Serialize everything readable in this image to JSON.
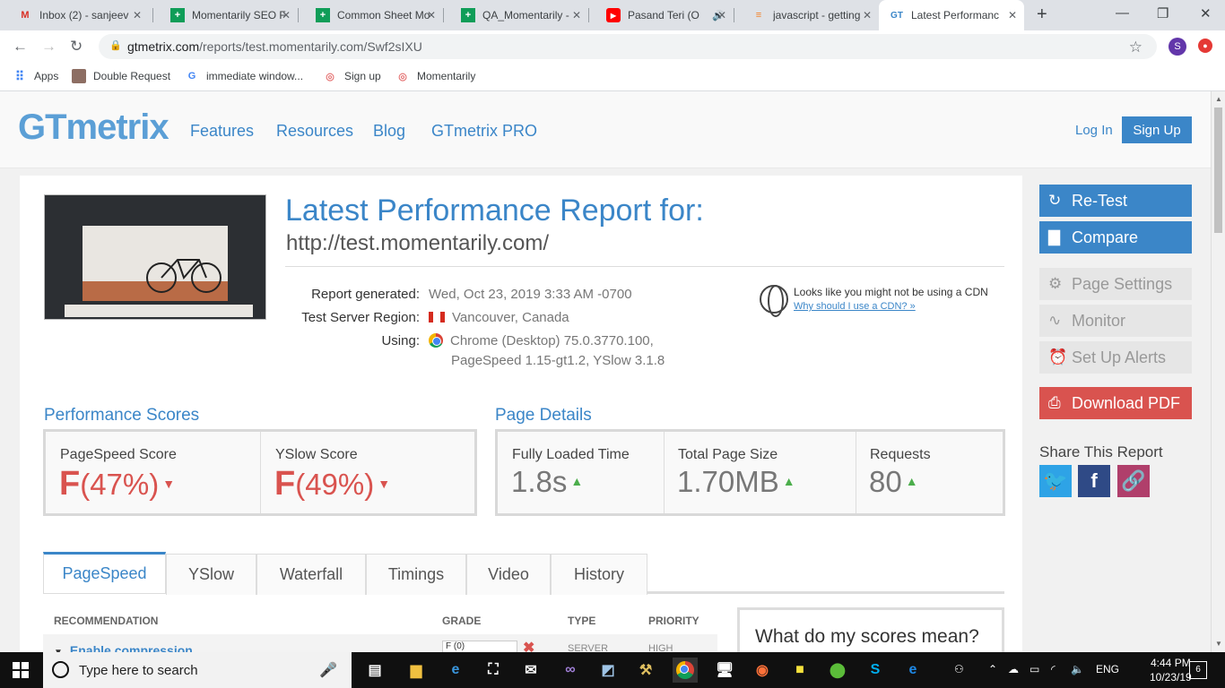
{
  "browser": {
    "tabs": [
      {
        "title": "Inbox (2) - sanjeev",
        "icon": "gmail-icon",
        "color": "#d93025"
      },
      {
        "title": "Momentarily SEO F",
        "icon": "sheets-icon",
        "color": "#0f9d58"
      },
      {
        "title": "Common Sheet Mo",
        "icon": "sheets-icon",
        "color": "#0f9d58"
      },
      {
        "title": "QA_Momentarily -",
        "icon": "sheets-icon",
        "color": "#0f9d58"
      },
      {
        "title": "Pasand Teri (O",
        "icon": "youtube-icon",
        "color": "#ff0000"
      },
      {
        "title": "javascript - getting",
        "icon": "stackoverflow-icon",
        "color": "#f48024"
      },
      {
        "title": "Latest Performanc",
        "icon": "gtmetrix-icon",
        "color": "#3b86c8"
      }
    ],
    "url_host": "gtmetrix.com",
    "url_path": "/reports/test.momentarily.com/Swf2sIXU",
    "profile_initial": "S",
    "bookmarks": [
      {
        "label": "Apps",
        "icon": "apps-grid-icon"
      },
      {
        "label": "Double Request",
        "icon": "user-thumb-icon"
      },
      {
        "label": "immediate window...",
        "icon": "google-icon"
      },
      {
        "label": "Sign up",
        "icon": "momentarily-icon"
      },
      {
        "label": "Momentarily",
        "icon": "momentarily-icon"
      }
    ]
  },
  "header": {
    "logo": "GTmetrix",
    "nav": [
      "Features",
      "Resources",
      "Blog",
      "GTmetrix PRO"
    ],
    "login": "Log In",
    "signup": "Sign Up"
  },
  "report": {
    "title": "Latest Performance Report for:",
    "url": "http://test.momentarily.com/",
    "generated_label": "Report generated:",
    "generated_value": "Wed, Oct 23, 2019 3:33 AM -0700",
    "region_label": "Test Server Region:",
    "region_value": "Vancouver, Canada",
    "using_label": "Using:",
    "using_line1": "Chrome (Desktop) 75.0.3770.100,",
    "using_line2": "PageSpeed 1.15-gt1.2, YSlow 3.1.8",
    "cdn_text": "Looks like you might not be using a CDN",
    "cdn_link": "Why should I use a CDN? »"
  },
  "scores": {
    "heading": "Performance Scores",
    "pagespeed_label": "PageSpeed Score",
    "pagespeed_grade": "F",
    "pagespeed_pct": "(47%)",
    "yslow_label": "YSlow Score",
    "yslow_grade": "F",
    "yslow_pct": "(49%)"
  },
  "details": {
    "heading": "Page Details",
    "load_label": "Fully Loaded Time",
    "load_value": "1.8s",
    "size_label": "Total Page Size",
    "size_value": "1.70MB",
    "req_label": "Requests",
    "req_value": "80"
  },
  "tabs": [
    "PageSpeed",
    "YSlow",
    "Waterfall",
    "Timings",
    "Video",
    "History"
  ],
  "table": {
    "headers": [
      "RECOMMENDATION",
      "GRADE",
      "TYPE",
      "PRIORITY"
    ],
    "row1": {
      "name": "Enable compression",
      "grade": "F (0)",
      "type": "SERVER",
      "priority": "HIGH"
    }
  },
  "scores_box_title": "What do my scores mean?",
  "sidebar": {
    "retest": "Re-Test",
    "compare": "Compare",
    "page_settings": "Page Settings",
    "monitor": "Monitor",
    "alerts": "Set Up Alerts",
    "download": "Download PDF",
    "share": "Share This Report"
  },
  "taskbar": {
    "search_placeholder": "Type here to search",
    "lang": "ENG",
    "time": "4:44 PM",
    "date": "10/23/19",
    "notif_count": "6"
  }
}
